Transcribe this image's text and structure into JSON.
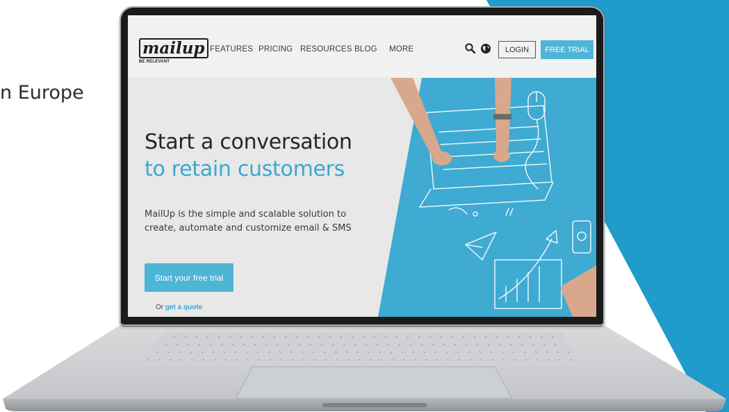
{
  "background": {
    "side_text": "n Europe",
    "accent_color": "#1f9ccb"
  },
  "site": {
    "logo": {
      "word": "mailup",
      "tagline": "BE RELEVANT"
    },
    "nav": {
      "items": [
        "FEATURES",
        "PRICING",
        "RESOURCES",
        "BLOG",
        "MORE"
      ],
      "search_icon": "search-icon",
      "globe_icon": "globe-icon",
      "login_label": "LOGIN",
      "free_trial_label": "FREE TRIAL"
    },
    "hero": {
      "title_line1": "Start a conversation",
      "title_line2": "to retain customers",
      "description": "MailUp is the simple and scalable solution to create, automate and customize email & SMS",
      "cta_label": "Start your free trial",
      "quote_prefix": "Or",
      "quote_link": "get a quote"
    },
    "colors": {
      "brand_blue": "#4db5d6",
      "hero_blue": "#3faad2",
      "text_dark": "#262626"
    }
  }
}
